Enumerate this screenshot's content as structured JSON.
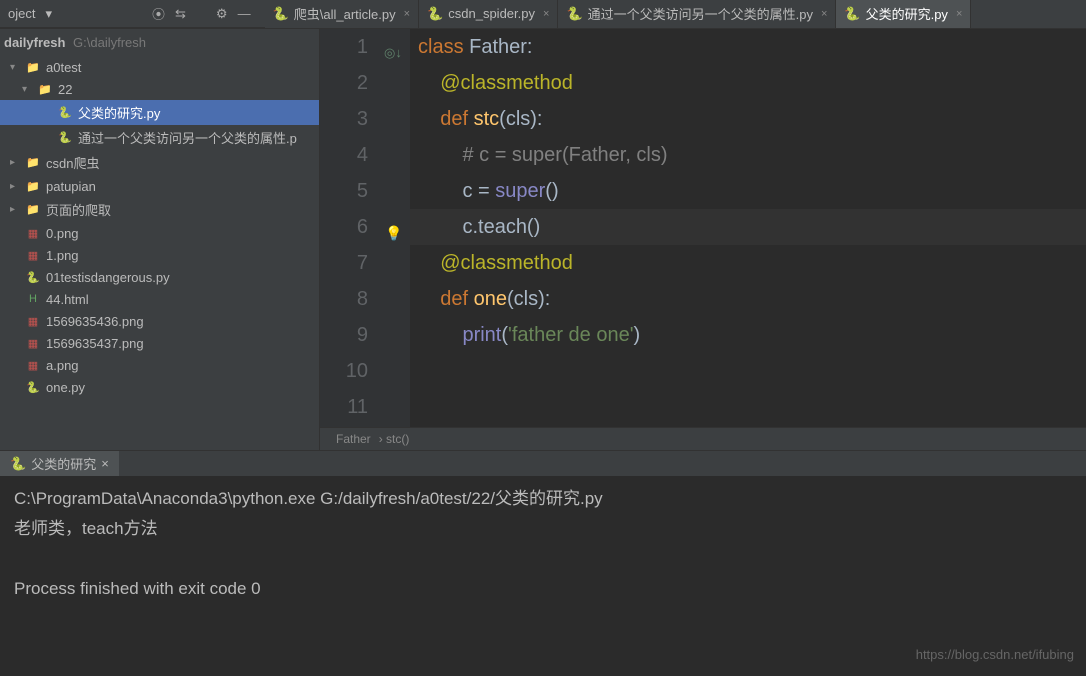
{
  "topbar": {
    "title": "oject",
    "chevron": "▾"
  },
  "tabs": [
    {
      "icon": "py",
      "label": "爬虫\\all_article.py",
      "active": false
    },
    {
      "icon": "py",
      "label": "csdn_spider.py",
      "active": false
    },
    {
      "icon": "py",
      "label": "通过一个父类访问另一个父类的属性.py",
      "active": false
    },
    {
      "icon": "py",
      "label": "父类的研究.py",
      "active": true
    }
  ],
  "project": {
    "name": "dailyfresh",
    "path": "G:\\dailyfresh"
  },
  "tree": [
    {
      "indent": 0,
      "arrow": "▾",
      "icon": "folder",
      "label": "a0test"
    },
    {
      "indent": 1,
      "arrow": "▾",
      "icon": "folder",
      "label": "22"
    },
    {
      "indent": 2,
      "arrow": "",
      "icon": "py",
      "label": "父类的研究.py",
      "selected": true
    },
    {
      "indent": 2,
      "arrow": "",
      "icon": "py",
      "label": "通过一个父类访问另一个父类的属性.p"
    },
    {
      "indent": 0,
      "arrow": "▸",
      "icon": "folder",
      "label": "csdn爬虫"
    },
    {
      "indent": 0,
      "arrow": "▸",
      "icon": "folder",
      "label": "patupian"
    },
    {
      "indent": 0,
      "arrow": "▸",
      "icon": "folder",
      "label": "页面的爬取"
    },
    {
      "indent": 0,
      "arrow": "",
      "icon": "png",
      "label": "0.png"
    },
    {
      "indent": 0,
      "arrow": "",
      "icon": "png",
      "label": "1.png"
    },
    {
      "indent": 0,
      "arrow": "",
      "icon": "py",
      "label": "01testisdangerous.py"
    },
    {
      "indent": 0,
      "arrow": "",
      "icon": "html",
      "label": "44.html"
    },
    {
      "indent": 0,
      "arrow": "",
      "icon": "png",
      "label": "1569635436.png"
    },
    {
      "indent": 0,
      "arrow": "",
      "icon": "png",
      "label": "1569635437.png"
    },
    {
      "indent": 0,
      "arrow": "",
      "icon": "png",
      "label": "a.png"
    },
    {
      "indent": 0,
      "arrow": "",
      "icon": "py",
      "label": "one.py"
    }
  ],
  "code": {
    "lines": [
      {
        "n": 1,
        "tokens": [
          {
            "t": "class ",
            "c": "kw"
          },
          {
            "t": "Father:",
            "c": ""
          }
        ]
      },
      {
        "n": 2,
        "tokens": [
          {
            "t": "    ",
            "c": ""
          },
          {
            "t": "@classmethod",
            "c": "deco"
          }
        ]
      },
      {
        "n": 3,
        "tokens": [
          {
            "t": "    ",
            "c": ""
          },
          {
            "t": "def ",
            "c": "kw"
          },
          {
            "t": "stc",
            "c": "fn"
          },
          {
            "t": "(cls):",
            "c": ""
          }
        ]
      },
      {
        "n": 4,
        "tokens": [
          {
            "t": "        ",
            "c": ""
          },
          {
            "t": "# c = super(Father, cls)",
            "c": "cmt"
          }
        ]
      },
      {
        "n": 5,
        "tokens": [
          {
            "t": "        c = ",
            "c": ""
          },
          {
            "t": "super",
            "c": "builtin"
          },
          {
            "t": "()",
            "c": ""
          }
        ]
      },
      {
        "n": 6,
        "tokens": [
          {
            "t": "        c.teach()",
            "c": ""
          }
        ]
      },
      {
        "n": 7,
        "tokens": [
          {
            "t": "",
            "c": ""
          }
        ]
      },
      {
        "n": 8,
        "tokens": [
          {
            "t": "    ",
            "c": ""
          },
          {
            "t": "@classmethod",
            "c": "deco"
          }
        ]
      },
      {
        "n": 9,
        "tokens": [
          {
            "t": "    ",
            "c": ""
          },
          {
            "t": "def ",
            "c": "kw"
          },
          {
            "t": "one",
            "c": "fn"
          },
          {
            "t": "(cls):",
            "c": ""
          }
        ]
      },
      {
        "n": 10,
        "tokens": [
          {
            "t": "        ",
            "c": ""
          },
          {
            "t": "print",
            "c": "builtin"
          },
          {
            "t": "(",
            "c": ""
          },
          {
            "t": "'father de one'",
            "c": "str"
          },
          {
            "t": ")",
            "c": ""
          }
        ]
      },
      {
        "n": 11,
        "tokens": [
          {
            "t": "",
            "c": ""
          }
        ]
      }
    ],
    "highlight_line": 6
  },
  "breadcrumb": [
    "Father",
    "stc()"
  ],
  "consoleTab": "父类的研究",
  "console": [
    "C:\\ProgramData\\Anaconda3\\python.exe G:/dailyfresh/a0test/22/父类的研究.py",
    "老师类，teach方法",
    "",
    "Process finished with exit code 0"
  ],
  "watermark": "https://blog.csdn.net/ifubing"
}
